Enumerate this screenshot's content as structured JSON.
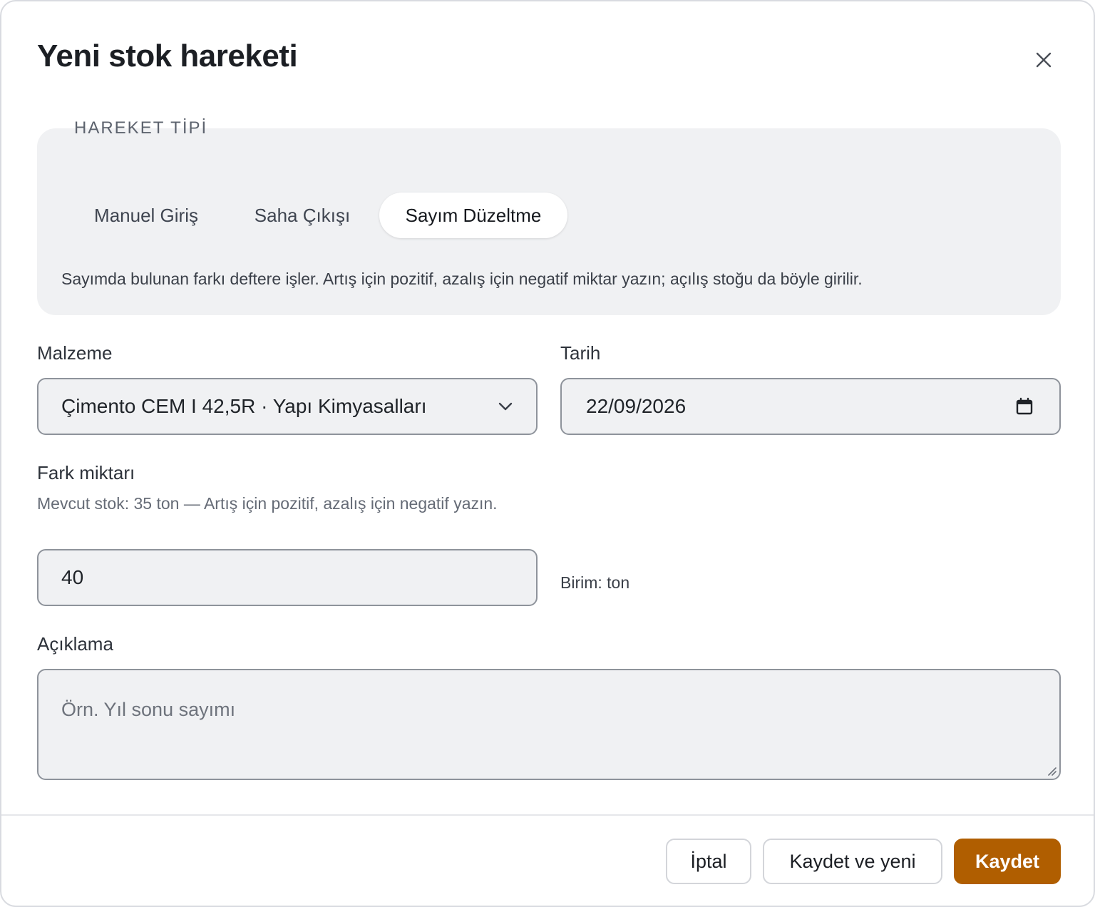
{
  "dialog": {
    "title": "Yeni stok hareketi",
    "close_icon": "close-icon"
  },
  "movement_type": {
    "legend": "HAREKET TİPİ",
    "options": [
      "Manuel Giriş",
      "Saha Çıkışı",
      "Sayım Düzeltme"
    ],
    "selected": "Sayım Düzeltme",
    "description": "Sayımda bulunan farkı deftere işler. Artış için pozitif, azalış için negatif miktar yazın; açılış stoğu da böyle girilir."
  },
  "material": {
    "label": "Malzeme",
    "value": "Çimento CEM I 42,5R · Yapı Kimyasalları",
    "icon": "chevron-down-icon"
  },
  "date": {
    "label": "Tarih",
    "value": "22/09/2026",
    "icon": "calendar-icon"
  },
  "difference": {
    "label": "Fark miktarı",
    "hint": "Mevcut stok: 35 ton — Artış için pozitif, azalış için negatif yazın.",
    "value": "40",
    "unit_text": "Birim: ton"
  },
  "description": {
    "label": "Açıklama",
    "placeholder": "Örn. Yıl sonu sayımı",
    "value": ""
  },
  "footer": {
    "cancel_label": "İptal",
    "save_new_label": "Kaydet ve yeni",
    "save_label": "Kaydet"
  },
  "colors": {
    "primary": "#b05e00",
    "panel": "#f0f1f3"
  }
}
